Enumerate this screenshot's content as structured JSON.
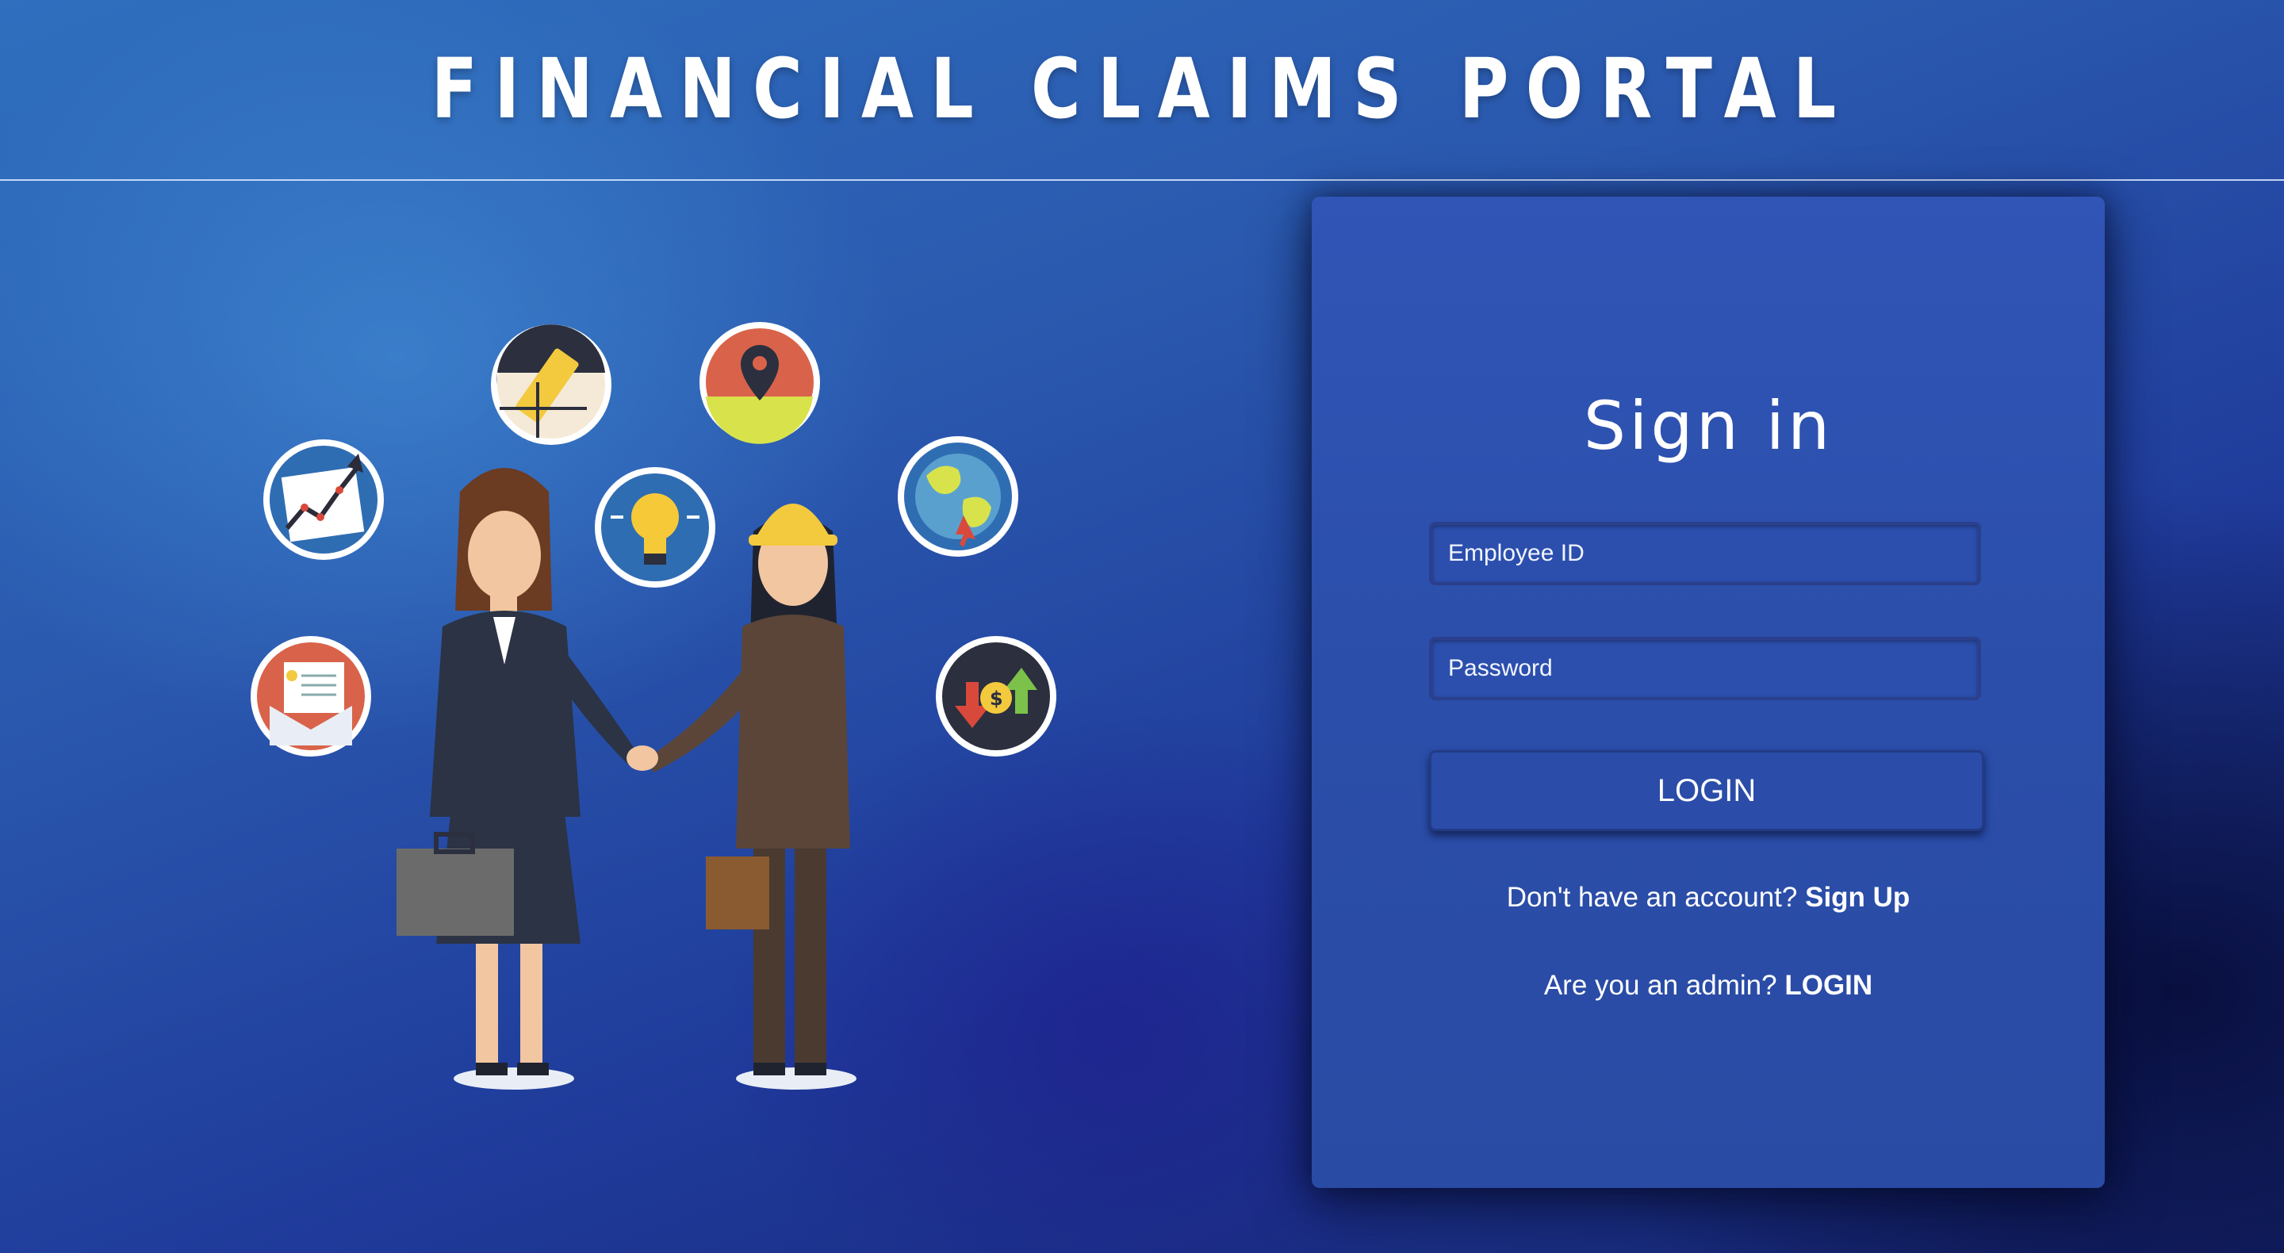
{
  "header": {
    "title": "FINANCIAL CLAIMS PORTAL"
  },
  "signin": {
    "title": "Sign in",
    "employee_id_placeholder": "Employee ID",
    "password_placeholder": "Password",
    "login_label": "LOGIN",
    "signup_prompt": "Don't have an account?",
    "signup_link": "Sign Up",
    "admin_prompt": "Are you an admin?",
    "admin_link": "LOGIN"
  },
  "colors": {
    "background_dark": "#15246e",
    "background_light": "#2f6fbe",
    "card": "#2b4eaa",
    "text": "#ffffff"
  },
  "illustration": {
    "icons": [
      "chart-icon",
      "pencil-ruler-icon",
      "map-pin-icon",
      "lightbulb-icon",
      "globe-icon",
      "certificate-envelope-icon",
      "currency-exchange-icon"
    ]
  }
}
